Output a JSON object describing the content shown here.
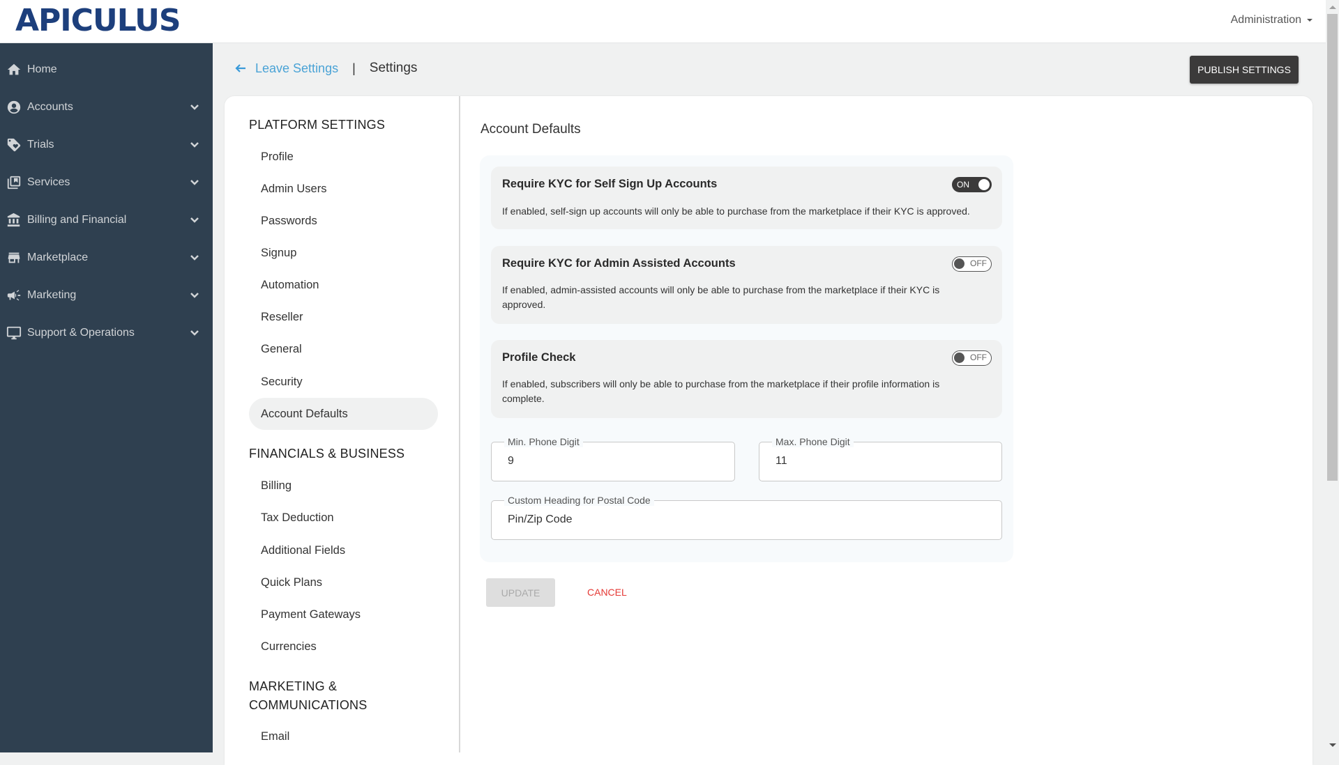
{
  "header": {
    "logo_text": "APICULUS",
    "admin_menu_label": "Administration"
  },
  "sidebar": {
    "items": [
      {
        "label": "Home",
        "icon": "home-icon",
        "expandable": false
      },
      {
        "label": "Accounts",
        "icon": "account-circle-icon",
        "expandable": true
      },
      {
        "label": "Trials",
        "icon": "tag-heart-icon",
        "expandable": true
      },
      {
        "label": "Services",
        "icon": "library-icon",
        "expandable": true
      },
      {
        "label": "Billing and Financial",
        "icon": "bank-icon",
        "expandable": true
      },
      {
        "label": "Marketplace",
        "icon": "store-icon",
        "expandable": true
      },
      {
        "label": "Marketing",
        "icon": "megaphone-icon",
        "expandable": true
      },
      {
        "label": "Support & Operations",
        "icon": "monitor-icon",
        "expandable": true
      }
    ]
  },
  "breadcrumb": {
    "back_label": "Leave Settings",
    "separator": "|",
    "current": "Settings"
  },
  "toolbar": {
    "publish_label": "PUBLISH SETTINGS"
  },
  "settings_nav": {
    "groups": [
      {
        "title": "PLATFORM SETTINGS",
        "items": [
          "Profile",
          "Admin Users",
          "Passwords",
          "Signup",
          "Automation",
          "Reseller",
          "General",
          "Security",
          "Account Defaults"
        ]
      },
      {
        "title": "FINANCIALS & BUSINESS",
        "items": [
          "Billing",
          "Tax Deduction",
          "Additional Fields",
          "Quick Plans",
          "Payment Gateways",
          "Currencies"
        ]
      },
      {
        "title_line1": "MARKETING &",
        "title_line2": "COMMUNICATIONS",
        "items": [
          "Email"
        ]
      }
    ],
    "active_item": "Account Defaults"
  },
  "main": {
    "title": "Account Defaults",
    "options": [
      {
        "title": "Require KYC for Self Sign Up Accounts",
        "description": "If enabled, self-sign up accounts will only be able to purchase from the marketplace if their KYC is approved.",
        "toggle_state": "ON"
      },
      {
        "title": "Require KYC for Admin Assisted Accounts",
        "description": "If enabled, admin-assisted accounts will only be able to purchase from the marketplace if their KYC is approved.",
        "toggle_state": "OFF"
      },
      {
        "title": "Profile Check",
        "description": "If enabled, subscribers will only be able to purchase from the marketplace if their profile information is complete.",
        "toggle_state": "OFF"
      }
    ],
    "fields": {
      "min_phone": {
        "label": "Min. Phone Digit",
        "value": "9"
      },
      "max_phone": {
        "label": "Max. Phone Digit",
        "value": "11"
      },
      "postal_heading": {
        "label": "Custom Heading for Postal Code",
        "value": "Pin/Zip Code"
      }
    },
    "actions": {
      "update_label": "UPDATE",
      "cancel_label": "CANCEL"
    }
  },
  "colors": {
    "sidebar_bg": "#2f4050",
    "brand": "#1d3f7c",
    "link": "#4aa3d6",
    "cancel": "#e53935",
    "dark_button": "#3b3a3a"
  }
}
